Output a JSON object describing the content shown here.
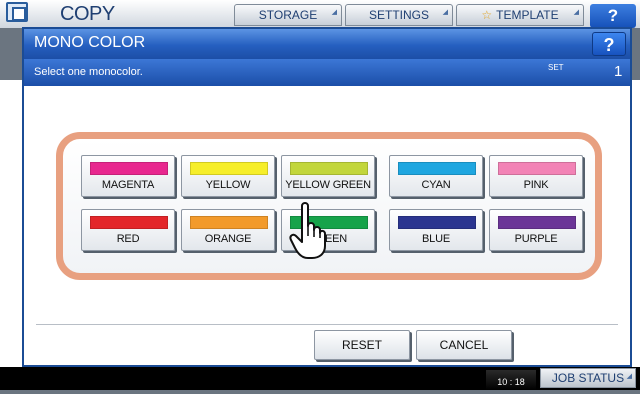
{
  "background": {
    "app_title": "COPY",
    "tabs": [
      {
        "label": "STORAGE"
      },
      {
        "label": "SETTINGS"
      },
      {
        "label": "TEMPLATE"
      }
    ],
    "help_label": "?",
    "clock": "10 : 18",
    "job_status_label": "JOB STATUS"
  },
  "dialog": {
    "title": "MONO COLOR",
    "help_label": "?",
    "instruction": "Select one monocolor.",
    "set_label": "SET",
    "set_value": "1",
    "colors": [
      {
        "label": "MAGENTA",
        "swatch": "#e8278f"
      },
      {
        "label": "YELLOW",
        "swatch": "#f6ee2a"
      },
      {
        "label": "YELLOW GREEN",
        "swatch": "#c2d63c"
      },
      {
        "label": "CYAN",
        "swatch": "#1ea6e0"
      },
      {
        "label": "PINK",
        "swatch": "#f283b6"
      },
      {
        "label": "RED",
        "swatch": "#e3262a"
      },
      {
        "label": "ORANGE",
        "swatch": "#f29a2b"
      },
      {
        "label": "GREEN",
        "swatch": "#16a34a"
      },
      {
        "label": "BLUE",
        "swatch": "#2b3590"
      },
      {
        "label": "PURPLE",
        "swatch": "#6b3597"
      }
    ],
    "reset_label": "RESET",
    "cancel_label": "CANCEL"
  }
}
